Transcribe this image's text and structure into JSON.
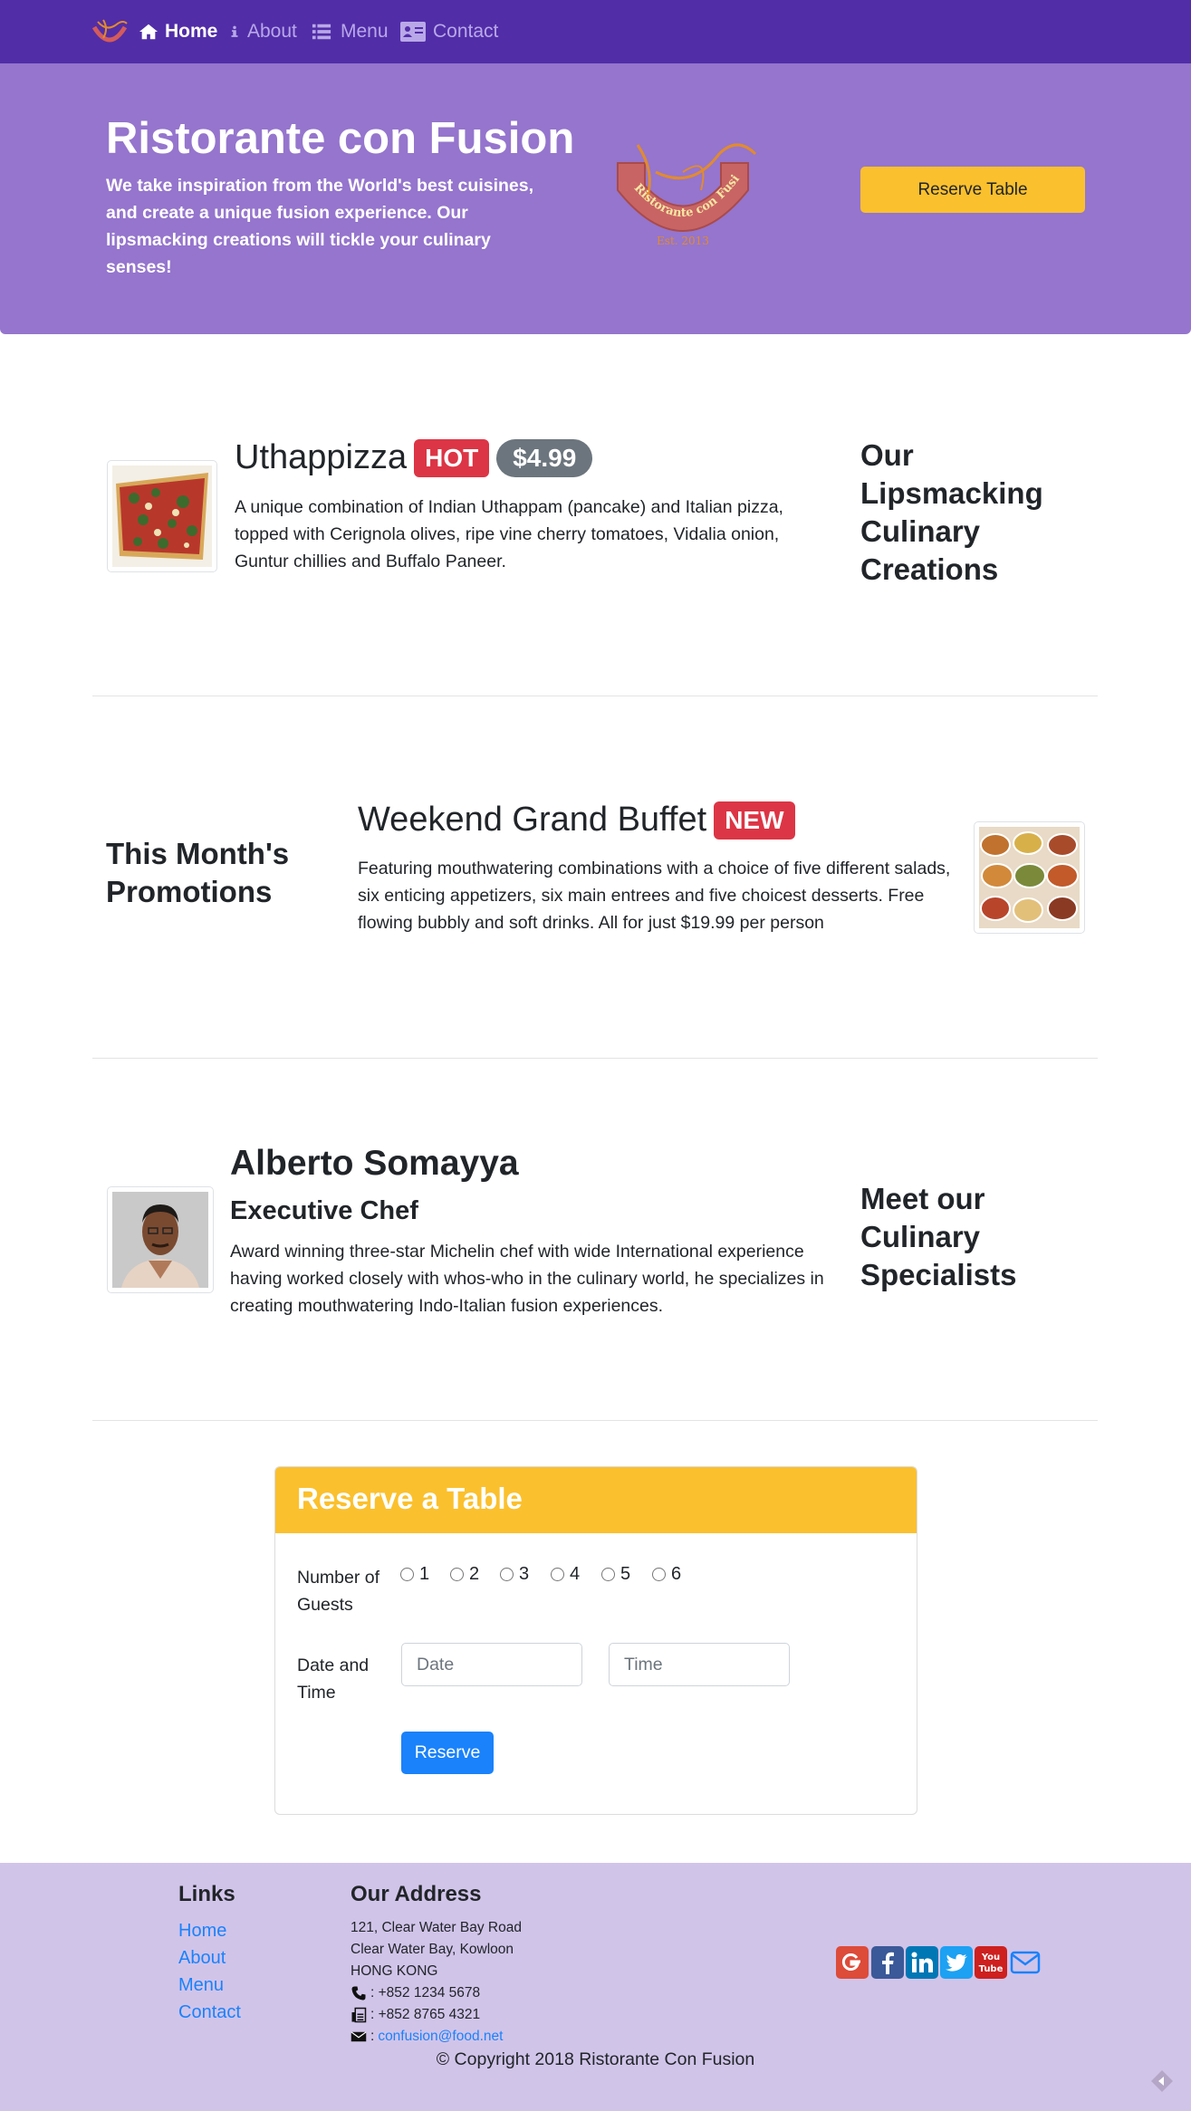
{
  "nav": {
    "items": [
      {
        "label": "Home",
        "icon": "home-icon"
      },
      {
        "label": "About",
        "icon": "info-icon"
      },
      {
        "label": "Menu",
        "icon": "list-icon"
      },
      {
        "label": "Contact",
        "icon": "address-card-icon"
      }
    ]
  },
  "jumbotron": {
    "title": "Ristorante con Fusion",
    "text": "We take inspiration from the World's best cuisines, and create a unique fusion experience. Our lipsmacking creations will tickle your culinary senses!",
    "logo_text": "Ristorante con Fusion",
    "logo_est": "Est. 2013",
    "reserve_button": "Reserve Table"
  },
  "dish": {
    "name": "Uthappizza",
    "badge": "HOT",
    "price": "$4.99",
    "description": "A unique combination of Indian Uthappam (pancake) and Italian pizza, topped with Cerignola olives, ripe vine cherry tomatoes, Vidalia onion, Guntur chillies and Buffalo Paneer.",
    "side_heading": "Our Lipsmacking Culinary Creations"
  },
  "promotion": {
    "side_heading": "This Month's Promotions",
    "name": "Weekend Grand Buffet",
    "badge": "NEW",
    "description": "Featuring mouthwatering combinations with a choice of five different salads, six enticing appetizers, six main entrees and five choicest desserts. Free flowing bubbly and soft drinks. All for just $19.99 per person"
  },
  "leader": {
    "name": "Alberto Somayya",
    "designation": "Executive Chef",
    "description": "Award winning three-star Michelin chef with wide International experience having worked closely with whos-who in the culinary world, he specializes in creating mouthwatering Indo-Italian fusion experiences.",
    "side_heading": "Meet our Culinary Specialists"
  },
  "reserve": {
    "title": "Reserve a Table",
    "guests_label": "Number of Guests",
    "guest_options": [
      "1",
      "2",
      "3",
      "4",
      "5",
      "6"
    ],
    "datetime_label": "Date and Time",
    "date_placeholder": "Date",
    "time_placeholder": "Time",
    "submit_label": "Reserve"
  },
  "footer": {
    "links_heading": "Links",
    "links": [
      "Home",
      "About",
      "Menu",
      "Contact"
    ],
    "address_heading": "Our Address",
    "address_lines": [
      "121, Clear Water Bay Road",
      "Clear Water Bay, Kowloon",
      "HONG KONG"
    ],
    "phone": ": +852 1234 5678",
    "fax": ": +852 8765 4321",
    "email_prefix": ":",
    "email": "confusion@food.net",
    "social": [
      "google-plus-icon",
      "facebook-icon",
      "linkedin-icon",
      "twitter-icon",
      "youtube-icon",
      "mail-icon"
    ],
    "copyright": "© Copyright 2018 Ristorante Con Fusion"
  },
  "colors": {
    "navbar": "#512da8",
    "jumbotron": "#9575cd",
    "accent": "#fbc02d",
    "footer": "#d1c4e9",
    "link": "#1a82fb",
    "badge_hot": "#dc3545",
    "badge_price": "#6c757d"
  }
}
